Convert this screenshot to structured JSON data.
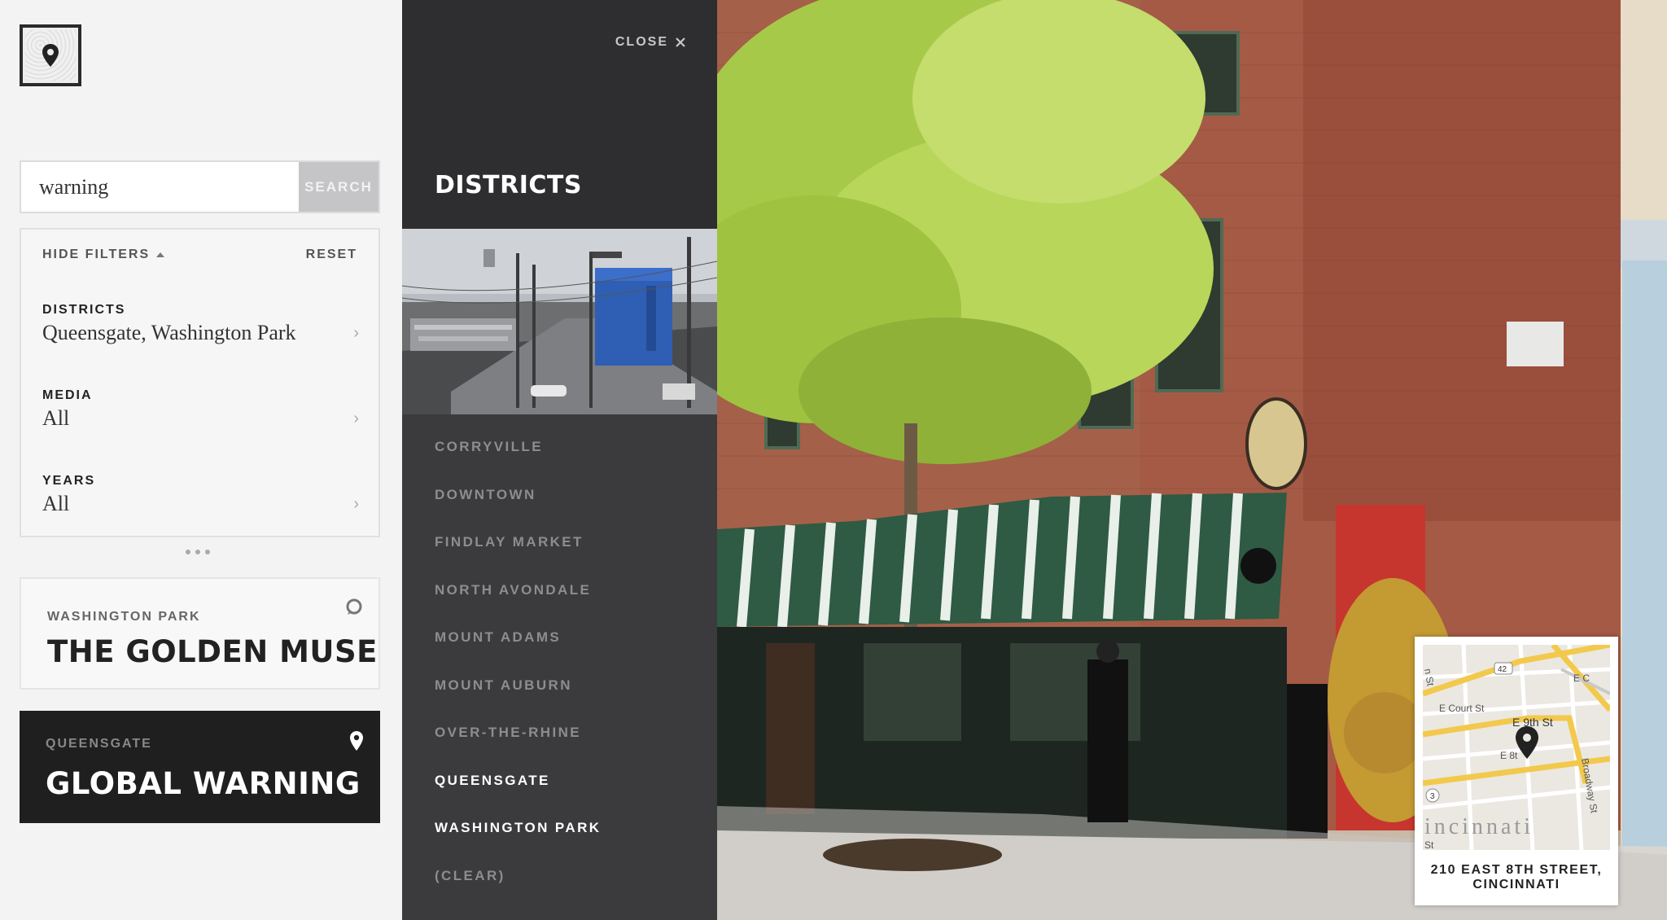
{
  "search": {
    "value": "warning",
    "button_label": "SEARCH"
  },
  "filters": {
    "hide_label": "HIDE FILTERS",
    "reset_label": "RESET",
    "items": [
      {
        "label": "DISTRICTS",
        "value": "Queensgate, Washington Park"
      },
      {
        "label": "MEDIA",
        "value": "All"
      },
      {
        "label": "YEARS",
        "value": "All"
      }
    ]
  },
  "results": [
    {
      "district": "WASHINGTON PARK",
      "title": "THE GOLDEN MUSE",
      "selected": false
    },
    {
      "district": "QUEENSGATE",
      "title": "GLOBAL WARNING",
      "selected": true
    }
  ],
  "panel": {
    "close_label": "CLOSE",
    "title": "DISTRICTS",
    "districts": [
      {
        "name": "CORRYVILLE",
        "selected": false
      },
      {
        "name": "DOWNTOWN",
        "selected": false
      },
      {
        "name": "FINDLAY MARKET",
        "selected": false
      },
      {
        "name": "NORTH AVONDALE",
        "selected": false
      },
      {
        "name": "MOUNT ADAMS",
        "selected": false
      },
      {
        "name": "MOUNT AUBURN",
        "selected": false
      },
      {
        "name": "OVER-THE-RHINE",
        "selected": false
      },
      {
        "name": "QUEENSGATE",
        "selected": true
      },
      {
        "name": "WASHINGTON PARK",
        "selected": true
      },
      {
        "name": "(CLEAR)",
        "selected": false
      }
    ]
  },
  "map": {
    "address_line1": "210 EAST 8TH STREET,",
    "address_line2": "CINCINNATI",
    "labels": {
      "e_court_st": "E Court St",
      "e_9th_st": "E 9th St",
      "e_8th": "E 8t",
      "broadway_st": "Broadway St",
      "e_c": "E C",
      "route_42": "42",
      "route_3": "3",
      "city": "incinnati",
      "n_st": "n St",
      "st": "St"
    }
  },
  "colors": {
    "accent_dark": "#1f1f1f",
    "panel_bg": "#3b3b3d",
    "panel_header_bg": "#2e2e30",
    "search_button": "#c5c5c7",
    "map_road": "#f2c94c"
  }
}
